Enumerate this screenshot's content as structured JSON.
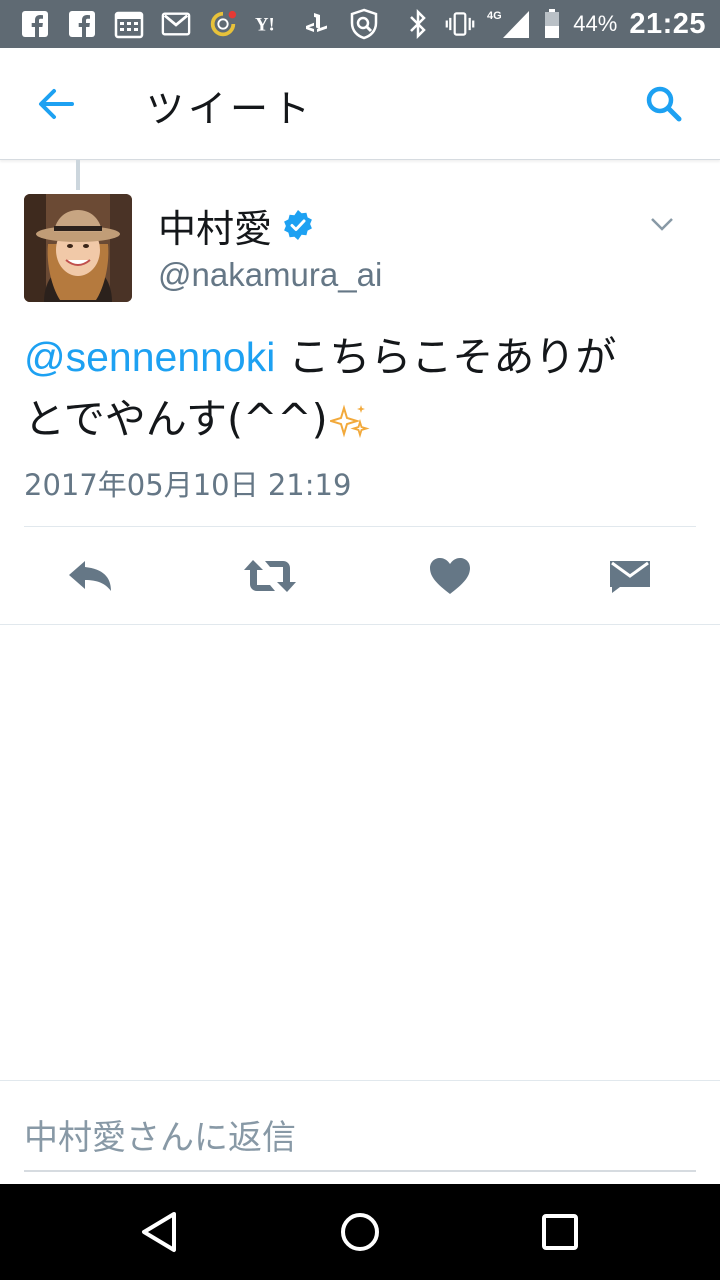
{
  "status_bar": {
    "network": "4G",
    "battery": "44%",
    "time": "21:25",
    "notification_icons": [
      "facebook-icon",
      "facebook-icon",
      "calendar-icon",
      "gmail-icon",
      "loop-app-icon",
      "yahoo-icon",
      "playstation-icon",
      "shield-icon"
    ]
  },
  "header": {
    "title": "ツイート",
    "back_icon": "arrow-left-icon",
    "search_icon": "search-icon"
  },
  "tweet": {
    "display_name": "中村愛",
    "verified": true,
    "handle": "@nakamura_ai",
    "mention": "@sennennoki",
    "text_line1": " こちらこそありが",
    "text_line2": "とでやんす(^^)",
    "timestamp": "2017年05月10日 21:19"
  },
  "actions": [
    "reply-icon",
    "retweet-icon",
    "like-icon",
    "direct-message-icon"
  ],
  "reply": {
    "placeholder": "中村愛さんに返信"
  },
  "colors": {
    "accent": "#1da1f2",
    "status_bar": "#5f6a73",
    "text": "#14171a",
    "secondary_text": "#657786"
  }
}
